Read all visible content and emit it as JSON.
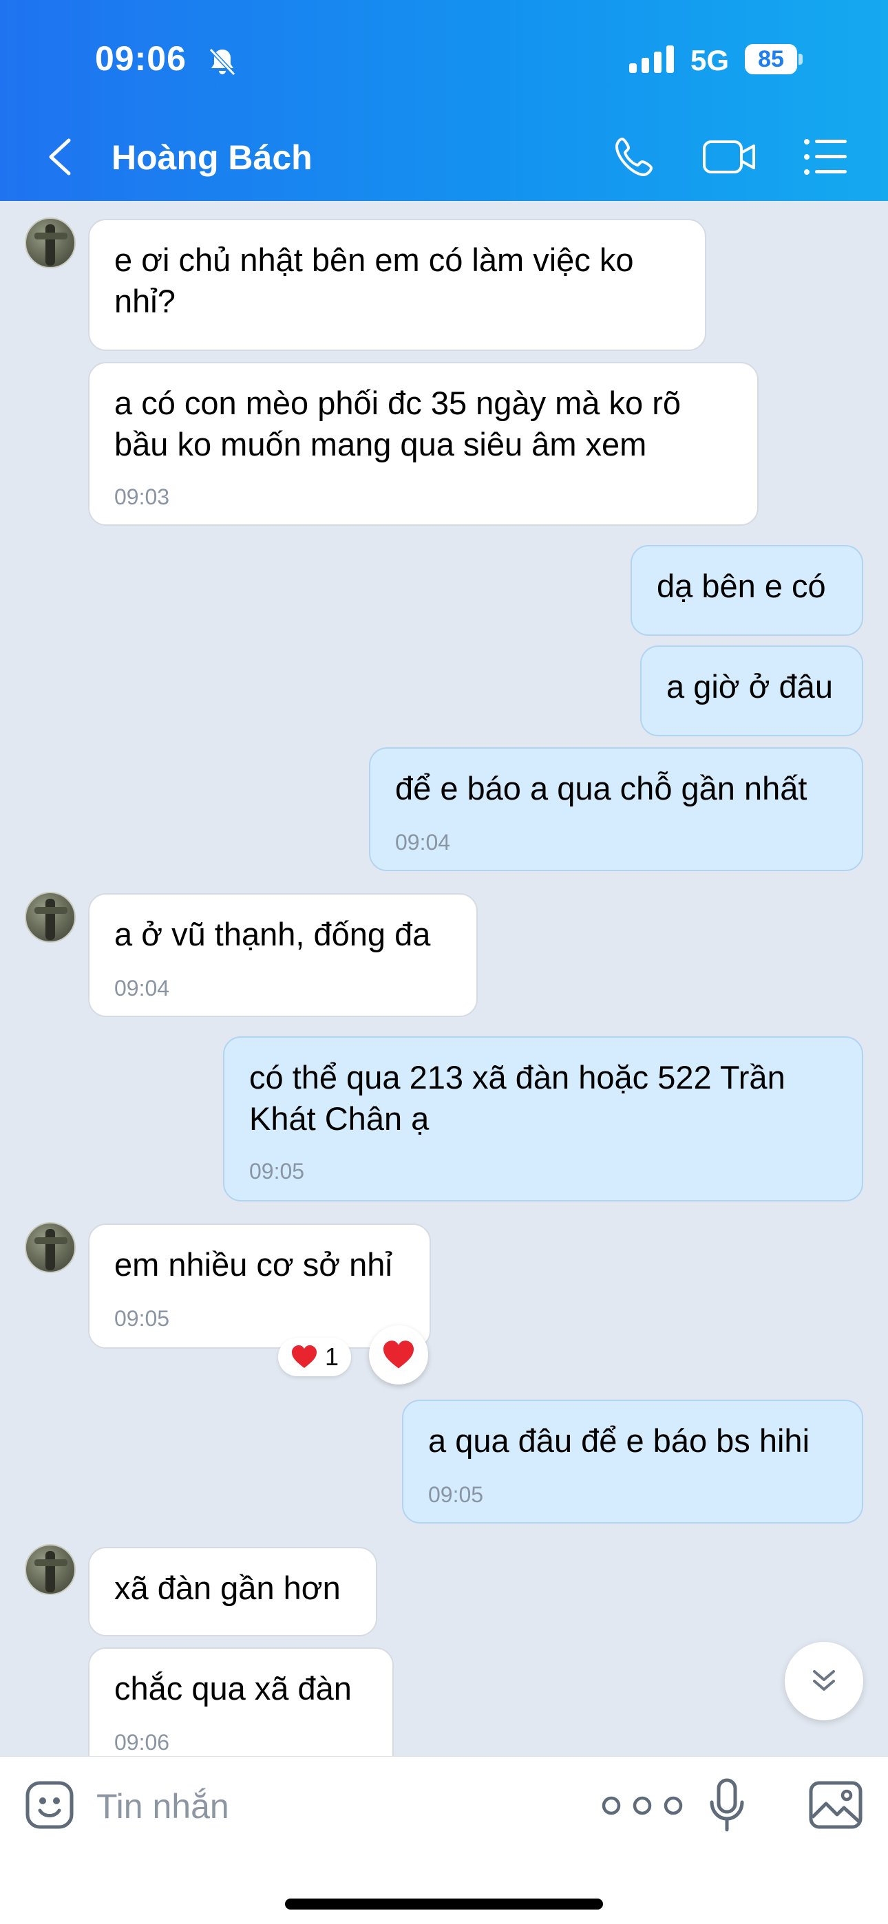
{
  "status_bar": {
    "time": "09:06",
    "network": "5G",
    "battery": "85"
  },
  "header": {
    "contact_name": "Hoàng Bách"
  },
  "messages": [
    {
      "side": "in",
      "text": "e ơi chủ nhật bên em có làm việc ko nhỉ?",
      "time": ""
    },
    {
      "side": "in",
      "text": "a có con mèo phối đc 35 ngày mà ko rõ bầu ko muốn mang qua siêu âm xem",
      "time": "09:03"
    },
    {
      "side": "out",
      "text": "dạ bên e có",
      "time": ""
    },
    {
      "side": "out",
      "text": "a giờ ở đâu",
      "time": ""
    },
    {
      "side": "out",
      "text": "để e báo a qua chỗ gần nhất",
      "time": "09:04"
    },
    {
      "side": "in",
      "text": "a ở vũ thạnh, đống đa",
      "time": "09:04"
    },
    {
      "side": "out",
      "text": "có thể qua 213 xã đàn hoặc 522 Trần Khát Chân ạ",
      "time": "09:05"
    },
    {
      "side": "in",
      "text": "em nhiều cơ sở nhỉ",
      "time": "09:05"
    },
    {
      "side": "out",
      "text": "a qua đâu để e báo bs hihi",
      "time": "09:05"
    },
    {
      "side": "in",
      "text": "xã đàn gần hơn",
      "time": ""
    },
    {
      "side": "in",
      "text": "chắc qua xã đàn",
      "time": "09:06"
    }
  ],
  "reaction": {
    "icon": "heart-icon",
    "count": "1",
    "color": "#e8242f"
  },
  "input": {
    "placeholder": "Tin nhắn"
  },
  "colors": {
    "header_start": "#1f73f0",
    "header_end": "#15a9f0",
    "chat_background": "#e2e8f1",
    "incoming_bubble": "#ffffff",
    "outgoing_bubble": "#d4ecfd"
  }
}
